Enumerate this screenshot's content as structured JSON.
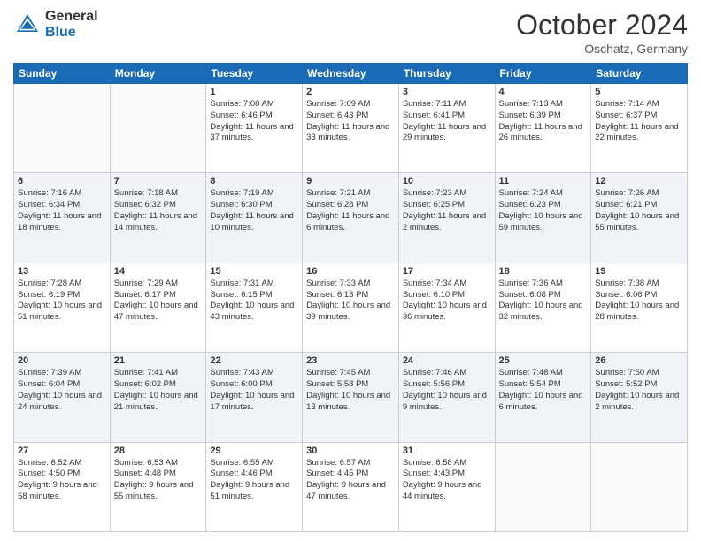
{
  "logo": {
    "general": "General",
    "blue": "Blue"
  },
  "header": {
    "month": "October 2024",
    "location": "Oschatz, Germany"
  },
  "weekdays": [
    "Sunday",
    "Monday",
    "Tuesday",
    "Wednesday",
    "Thursday",
    "Friday",
    "Saturday"
  ],
  "weeks": [
    [
      {
        "day": "",
        "info": ""
      },
      {
        "day": "",
        "info": ""
      },
      {
        "day": "1",
        "info": "Sunrise: 7:08 AM\nSunset: 6:46 PM\nDaylight: 11 hours\nand 37 minutes."
      },
      {
        "day": "2",
        "info": "Sunrise: 7:09 AM\nSunset: 6:43 PM\nDaylight: 11 hours\nand 33 minutes."
      },
      {
        "day": "3",
        "info": "Sunrise: 7:11 AM\nSunset: 6:41 PM\nDaylight: 11 hours\nand 29 minutes."
      },
      {
        "day": "4",
        "info": "Sunrise: 7:13 AM\nSunset: 6:39 PM\nDaylight: 11 hours\nand 26 minutes."
      },
      {
        "day": "5",
        "info": "Sunrise: 7:14 AM\nSunset: 6:37 PM\nDaylight: 11 hours\nand 22 minutes."
      }
    ],
    [
      {
        "day": "6",
        "info": "Sunrise: 7:16 AM\nSunset: 6:34 PM\nDaylight: 11 hours\nand 18 minutes."
      },
      {
        "day": "7",
        "info": "Sunrise: 7:18 AM\nSunset: 6:32 PM\nDaylight: 11 hours\nand 14 minutes."
      },
      {
        "day": "8",
        "info": "Sunrise: 7:19 AM\nSunset: 6:30 PM\nDaylight: 11 hours\nand 10 minutes."
      },
      {
        "day": "9",
        "info": "Sunrise: 7:21 AM\nSunset: 6:28 PM\nDaylight: 11 hours\nand 6 minutes."
      },
      {
        "day": "10",
        "info": "Sunrise: 7:23 AM\nSunset: 6:25 PM\nDaylight: 11 hours\nand 2 minutes."
      },
      {
        "day": "11",
        "info": "Sunrise: 7:24 AM\nSunset: 6:23 PM\nDaylight: 10 hours\nand 59 minutes."
      },
      {
        "day": "12",
        "info": "Sunrise: 7:26 AM\nSunset: 6:21 PM\nDaylight: 10 hours\nand 55 minutes."
      }
    ],
    [
      {
        "day": "13",
        "info": "Sunrise: 7:28 AM\nSunset: 6:19 PM\nDaylight: 10 hours\nand 51 minutes."
      },
      {
        "day": "14",
        "info": "Sunrise: 7:29 AM\nSunset: 6:17 PM\nDaylight: 10 hours\nand 47 minutes."
      },
      {
        "day": "15",
        "info": "Sunrise: 7:31 AM\nSunset: 6:15 PM\nDaylight: 10 hours\nand 43 minutes."
      },
      {
        "day": "16",
        "info": "Sunrise: 7:33 AM\nSunset: 6:13 PM\nDaylight: 10 hours\nand 39 minutes."
      },
      {
        "day": "17",
        "info": "Sunrise: 7:34 AM\nSunset: 6:10 PM\nDaylight: 10 hours\nand 36 minutes."
      },
      {
        "day": "18",
        "info": "Sunrise: 7:36 AM\nSunset: 6:08 PM\nDaylight: 10 hours\nand 32 minutes."
      },
      {
        "day": "19",
        "info": "Sunrise: 7:38 AM\nSunset: 6:06 PM\nDaylight: 10 hours\nand 28 minutes."
      }
    ],
    [
      {
        "day": "20",
        "info": "Sunrise: 7:39 AM\nSunset: 6:04 PM\nDaylight: 10 hours\nand 24 minutes."
      },
      {
        "day": "21",
        "info": "Sunrise: 7:41 AM\nSunset: 6:02 PM\nDaylight: 10 hours\nand 21 minutes."
      },
      {
        "day": "22",
        "info": "Sunrise: 7:43 AM\nSunset: 6:00 PM\nDaylight: 10 hours\nand 17 minutes."
      },
      {
        "day": "23",
        "info": "Sunrise: 7:45 AM\nSunset: 5:58 PM\nDaylight: 10 hours\nand 13 minutes."
      },
      {
        "day": "24",
        "info": "Sunrise: 7:46 AM\nSunset: 5:56 PM\nDaylight: 10 hours\nand 9 minutes."
      },
      {
        "day": "25",
        "info": "Sunrise: 7:48 AM\nSunset: 5:54 PM\nDaylight: 10 hours\nand 6 minutes."
      },
      {
        "day": "26",
        "info": "Sunrise: 7:50 AM\nSunset: 5:52 PM\nDaylight: 10 hours\nand 2 minutes."
      }
    ],
    [
      {
        "day": "27",
        "info": "Sunrise: 6:52 AM\nSunset: 4:50 PM\nDaylight: 9 hours\nand 58 minutes."
      },
      {
        "day": "28",
        "info": "Sunrise: 6:53 AM\nSunset: 4:48 PM\nDaylight: 9 hours\nand 55 minutes."
      },
      {
        "day": "29",
        "info": "Sunrise: 6:55 AM\nSunset: 4:46 PM\nDaylight: 9 hours\nand 51 minutes."
      },
      {
        "day": "30",
        "info": "Sunrise: 6:57 AM\nSunset: 4:45 PM\nDaylight: 9 hours\nand 47 minutes."
      },
      {
        "day": "31",
        "info": "Sunrise: 6:58 AM\nSunset: 4:43 PM\nDaylight: 9 hours\nand 44 minutes."
      },
      {
        "day": "",
        "info": ""
      },
      {
        "day": "",
        "info": ""
      }
    ]
  ]
}
